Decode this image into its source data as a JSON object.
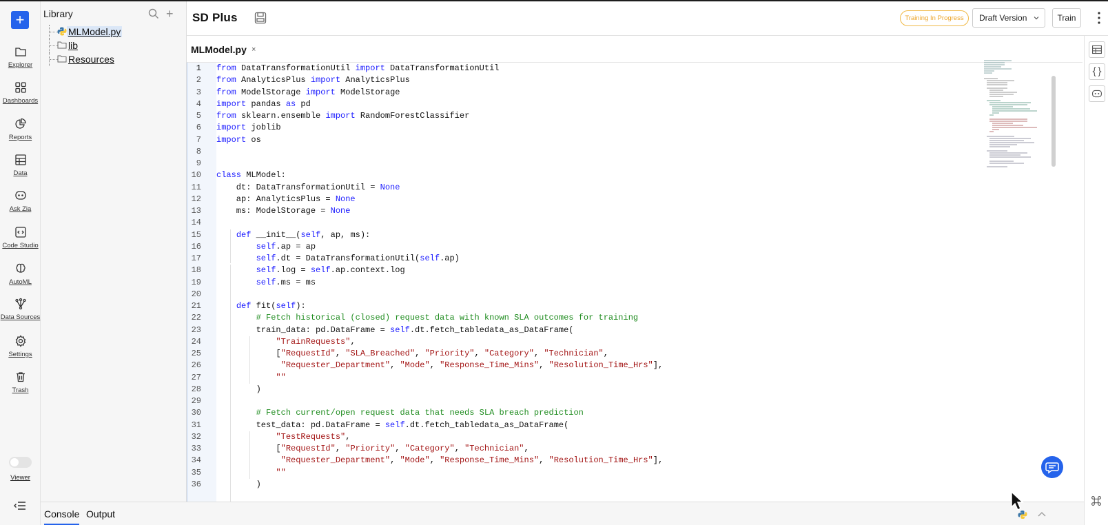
{
  "rail": {
    "new_label": "+",
    "items": [
      {
        "label": "Explorer",
        "icon": "folder-icon"
      },
      {
        "label": "Dashboards",
        "icon": "grid-icon"
      },
      {
        "label": "Reports",
        "icon": "pie-chart-icon"
      },
      {
        "label": "Data",
        "icon": "table-icon"
      },
      {
        "label": "Ask Zia",
        "icon": "chat-bot-icon"
      },
      {
        "label": "Code Studio",
        "icon": "code-icon"
      },
      {
        "label": "AutoML",
        "icon": "brain-icon"
      },
      {
        "label": "Data Sources",
        "icon": "data-source-icon"
      },
      {
        "label": "Settings",
        "icon": "gear-icon"
      },
      {
        "label": "Trash",
        "icon": "trash-icon"
      }
    ],
    "viewer_label": "Viewer"
  },
  "library": {
    "title": "Library",
    "tree": [
      {
        "name": "MLModel.py",
        "type": "python",
        "selected": true
      },
      {
        "name": "lib",
        "type": "folder"
      },
      {
        "name": "Resources",
        "type": "folder"
      }
    ]
  },
  "header": {
    "title": "SD Plus",
    "status_badge": "Training In Progress",
    "version_select": "Draft Version",
    "train_label": "Train",
    "accent_color": "#2563eb",
    "badge_color": "#eca52a"
  },
  "editor": {
    "tab_label": "MLModel.py",
    "tab_close": "×",
    "lines": [
      "from DataTransformationUtil import DataTransformationUtil",
      "from AnalyticsPlus import AnalyticsPlus",
      "from ModelStorage import ModelStorage",
      "import pandas as pd",
      "from sklearn.ensemble import RandomForestClassifier",
      "import joblib",
      "import os",
      "",
      "",
      "class MLModel:",
      "    dt: DataTransformationUtil = None",
      "    ap: AnalyticsPlus = None",
      "    ms: ModelStorage = None",
      "",
      "    def __init__(self, ap, ms):",
      "        self.ap = ap",
      "        self.dt = DataTransformationUtil(self.ap)",
      "        self.log = self.ap.context.log",
      "        self.ms = ms",
      "",
      "    def fit(self):",
      "        # Fetch historical (closed) request data with known SLA outcomes for training",
      "        train_data: pd.DataFrame = self.dt.fetch_tabledata_as_DataFrame(",
      "            \"TrainRequests\",",
      "            [\"RequestId\", \"SLA_Breached\", \"Priority\", \"Category\", \"Technician\",",
      "             \"Requester_Department\", \"Mode\", \"Response_Time_Mins\", \"Resolution_Time_Hrs\"],",
      "            \"\"",
      "        )",
      "",
      "        # Fetch current/open request data that needs SLA breach prediction",
      "        test_data: pd.DataFrame = self.dt.fetch_tabledata_as_DataFrame(",
      "            \"TestRequests\",",
      "            [\"RequestId\", \"Priority\", \"Category\", \"Technician\",",
      "             \"Requester_Department\", \"Mode\", \"Response_Time_Mins\", \"Resolution_Time_Hrs\"],",
      "            \"\"",
      "        )"
    ]
  },
  "bottom": {
    "tabs": [
      {
        "label": "Console",
        "active": true
      },
      {
        "label": "Output",
        "active": false
      }
    ]
  }
}
